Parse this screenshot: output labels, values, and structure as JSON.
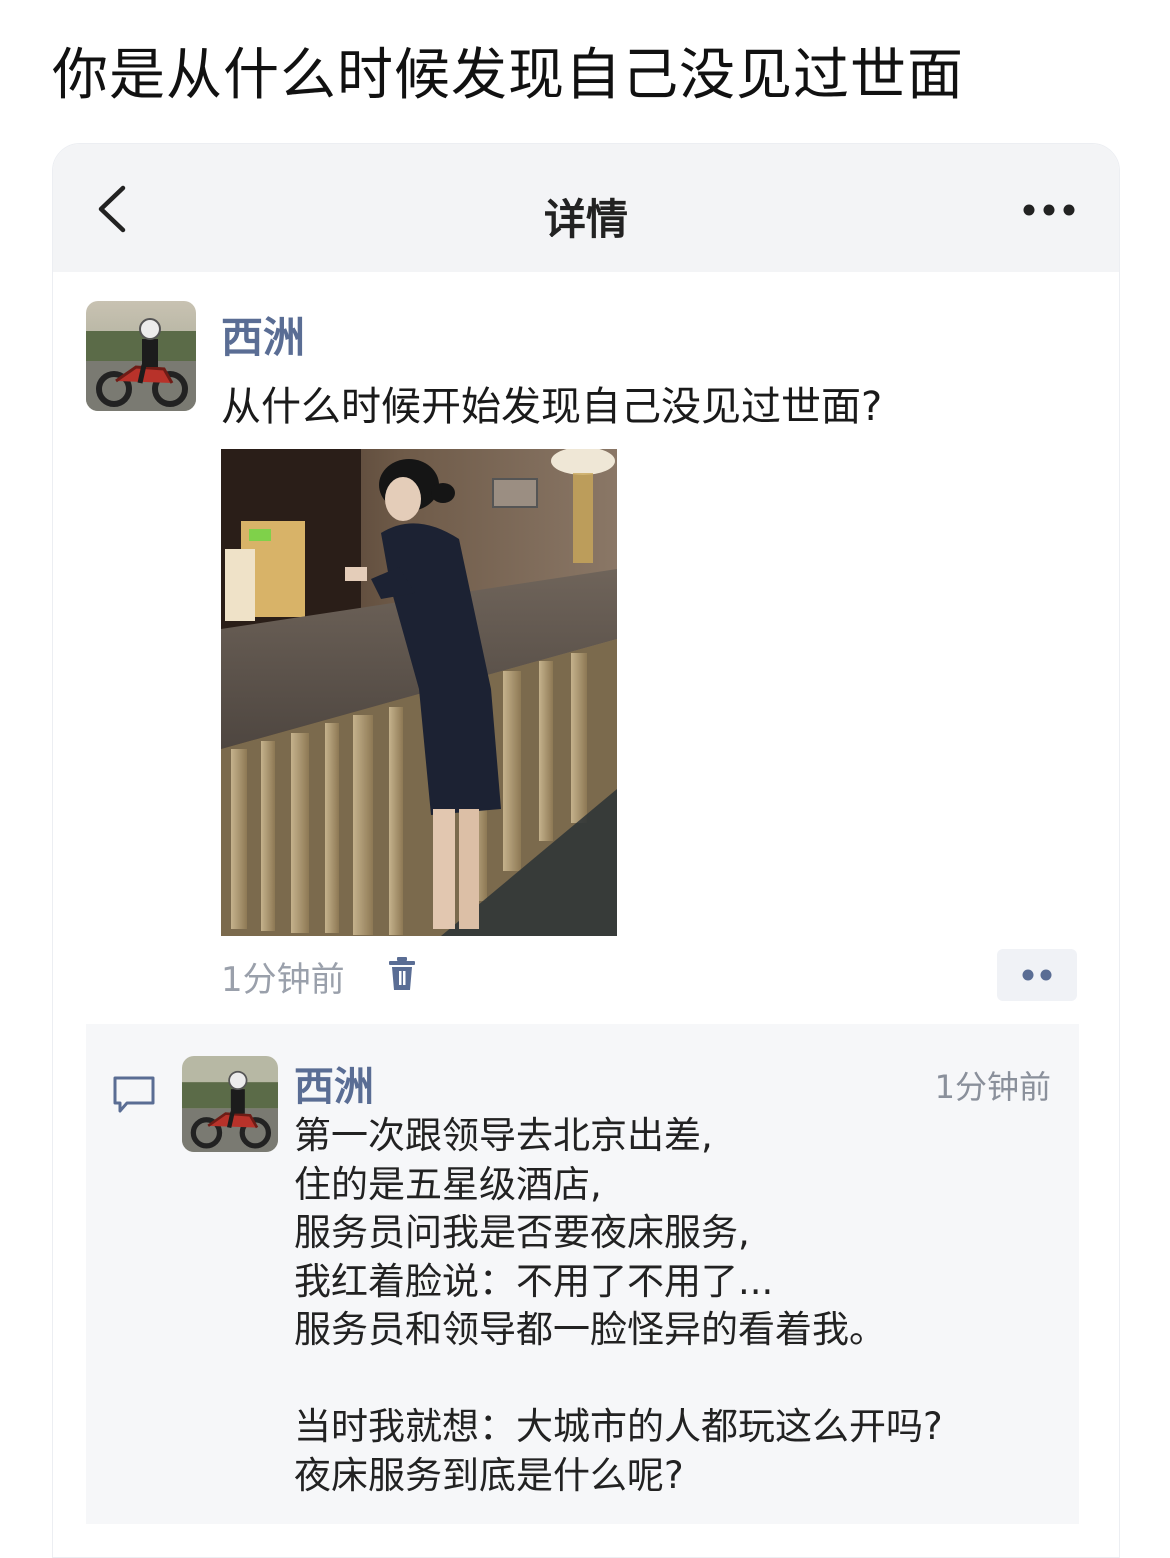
{
  "page_title": "你是从什么时候发现自己没见过世面",
  "navbar": {
    "title": "详情"
  },
  "post": {
    "author": "西洲",
    "text": "从什么时候开始发现自己没见过世面?",
    "time": "1分钟前"
  },
  "reply": {
    "author": "西洲",
    "time": "1分钟前",
    "lines": [
      "第一次跟领导去北京出差,",
      "住的是五星级酒店,",
      "服务员问我是否要夜床服务,",
      "我红着脸说：不用了不用了...",
      "服务员和领导都一脸怪异的看着我。",
      "",
      "当时我就想：大城市的人都玩这么开吗?",
      "夜床服务到底是什么呢?"
    ]
  },
  "icons": {
    "back": "chevron-left-icon",
    "more": "more-horizontal-icon",
    "delete": "trash-icon",
    "actions": "two-dots-icon",
    "comment": "comment-icon"
  },
  "colors": {
    "author_name": "#5a6d94",
    "navbar_bg": "#f3f4f6",
    "reply_bg": "#f6f7f9",
    "muted_text": "#9aa0ab"
  }
}
